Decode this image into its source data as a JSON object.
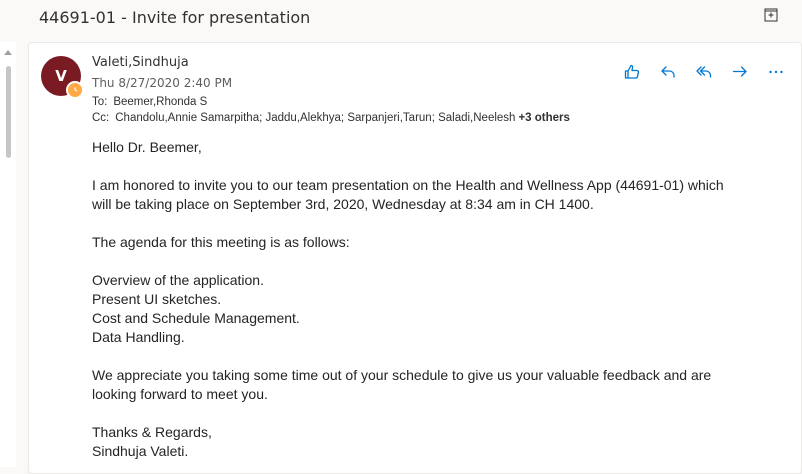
{
  "email": {
    "subject": "44691-01 - Invite for presentation",
    "sender": "Valeti,Sindhuja",
    "avatar_initial": "V",
    "date": "Thu 8/27/2020 2:40 PM",
    "to_label": "To:",
    "to": "Beemer,Rhonda S",
    "cc_label": "Cc:",
    "cc": "Chandolu,Annie Samarpitha; Jaddu,Alekhya; Sarpanjeri,Tarun; Saladi,Neelesh",
    "cc_more": "+3 others",
    "accent_color": "#0078d4",
    "avatar_color": "#7a1b24",
    "body": {
      "greeting": "Hello Dr. Beemer,",
      "para1_line1": "I am honored to invite you to our team presentation on the Health and Wellness App (44691-01) which",
      "para1_line2": "will be taking place on September 3rd, 2020, Wednesday at 8:34 am in CH 1400.",
      "agenda_intro": "The agenda for this meeting is as follows:",
      "agenda_items": [
        "Overview of the application.",
        "Present UI sketches.",
        "Cost and Schedule Management.",
        "Data Handling."
      ],
      "para3_line1": "We appreciate you taking some time out of your schedule to give us your valuable feedback and are",
      "para3_line2": "looking forward to meet you.",
      "closing": "Thanks & Regards,",
      "signature": "Sindhuja Valeti."
    }
  },
  "actions": [
    {
      "name": "like-icon"
    },
    {
      "name": "reply-icon"
    },
    {
      "name": "reply-all-icon"
    },
    {
      "name": "forward-icon"
    },
    {
      "name": "more-options-icon"
    }
  ],
  "icons": {
    "popout": "popout-icon",
    "presence": "away-clock-icon"
  }
}
